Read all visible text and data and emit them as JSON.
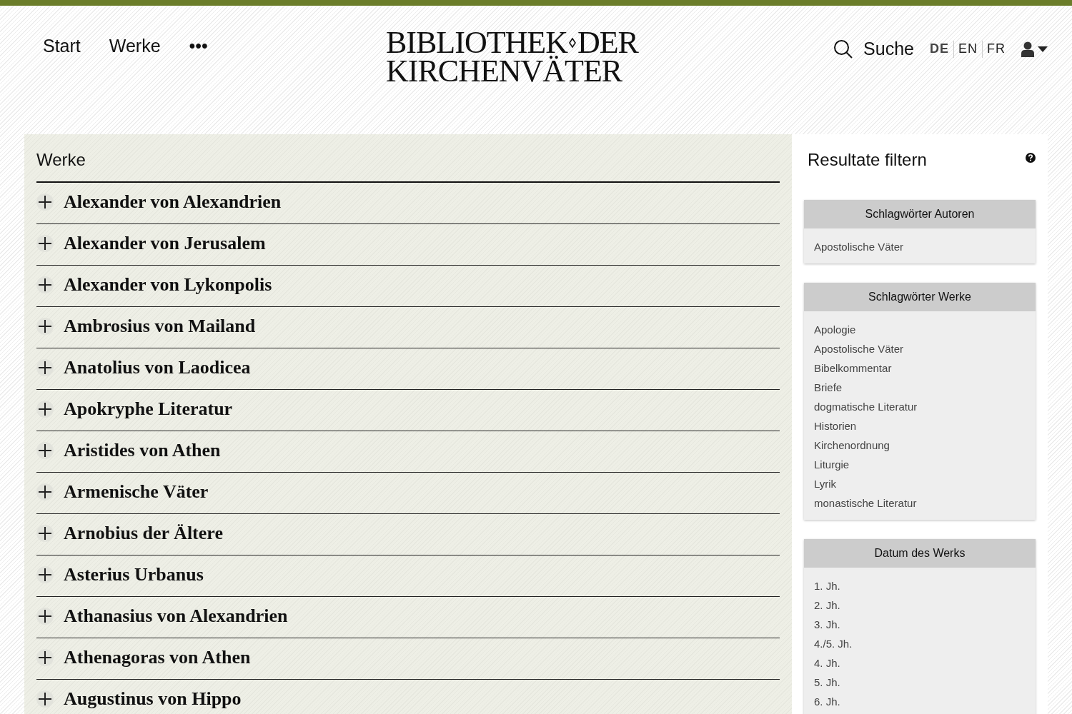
{
  "nav": [
    {
      "label": "Start"
    },
    {
      "label": "Werke"
    },
    {
      "label": "•••"
    }
  ],
  "logo": {
    "line_1a": "BIBLIOTHEK",
    "line_1b": "DER",
    "line_2": "KIRCHENVÄTER"
  },
  "search": {
    "label": "Suche"
  },
  "languages": [
    {
      "label": "DE",
      "selected": true
    },
    {
      "label": "EN",
      "selected": false
    },
    {
      "label": "FR",
      "selected": false
    }
  ],
  "works": {
    "title": "Werke",
    "items": [
      {
        "label": "Alexander von Alexandrien"
      },
      {
        "label": "Alexander von Jerusalem"
      },
      {
        "label": "Alexander von Lykonpolis"
      },
      {
        "label": "Ambrosius von Mailand"
      },
      {
        "label": "Anatolius von Laodicea"
      },
      {
        "label": "Apokryphe Literatur"
      },
      {
        "label": "Aristides von Athen"
      },
      {
        "label": "Armenische Väter"
      },
      {
        "label": "Arnobius der Ältere"
      },
      {
        "label": "Asterius Urbanus"
      },
      {
        "label": "Athanasius von Alexandrien"
      },
      {
        "label": "Athenagoras von Athen"
      },
      {
        "label": "Augustinus von Hippo"
      }
    ]
  },
  "filters": {
    "title": "Resultate filtern",
    "groups": [
      {
        "title": "Schlagwörter Autoren",
        "items": [
          "Apostolische Väter"
        ]
      },
      {
        "title": "Schlagwörter Werke",
        "items": [
          "Apologie",
          "Apostolische Väter",
          "Bibelkommentar",
          "Briefe",
          "dogmatische Literatur",
          "Historien",
          "Kirchenordnung",
          "Liturgie",
          "Lyrik",
          "monastische Literatur"
        ]
      },
      {
        "title": "Datum des Werks",
        "items": [
          "1. Jh.",
          "2. Jh.",
          "3. Jh.",
          "4./5. Jh.",
          "4. Jh.",
          "5. Jh.",
          "6. Jh."
        ]
      }
    ]
  }
}
